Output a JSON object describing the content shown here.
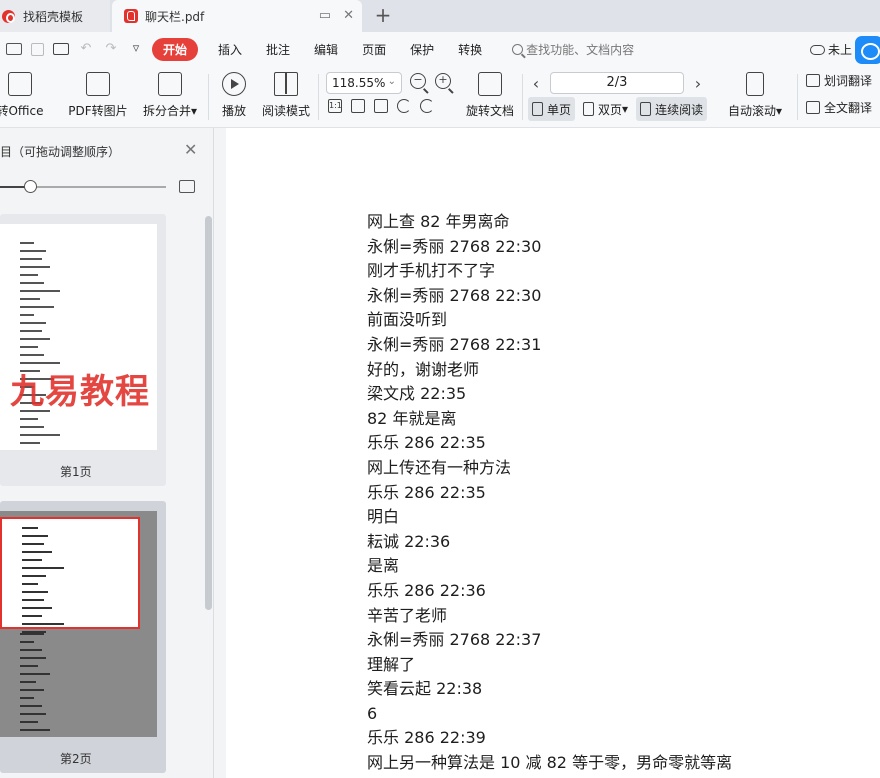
{
  "tabs": {
    "inactive_label": "找稻壳模板",
    "active_label": "聊天栏.pdf",
    "new_tab": "+"
  },
  "menu": {
    "start": "开始",
    "items": [
      "插入",
      "批注",
      "编辑",
      "页面",
      "保护",
      "转换"
    ],
    "search_placeholder": "查找功能、文档内容",
    "cloud_status": "未上"
  },
  "toolbar": {
    "to_office": "转Office",
    "pdf_to_image": "PDF转图片",
    "split_merge": "拆分合并",
    "play": "播放",
    "read_mode": "阅读模式",
    "zoom": "118.55%",
    "rotate_doc": "旋转文档",
    "page_indicator": "2/3",
    "single_page": "单页",
    "double_page": "双页",
    "continuous": "连续阅读",
    "auto_scroll": "自动滚动",
    "word_translate": "划词翻译",
    "full_translate": "全文翻译",
    "actual_size": "1:1"
  },
  "sidebar": {
    "title": "目（可拖动调整顺序）",
    "watermark": "九易教程",
    "page1_label": "第1页",
    "page2_label": "第2页"
  },
  "document": {
    "lines": [
      "网上查 82 年男离命",
      "永俐=秀丽 2768 22:30",
      "刚才手机打不了字",
      "永俐=秀丽 2768 22:30",
      "前面没听到",
      "永俐=秀丽 2768 22:31",
      "好的，谢谢老师",
      "梁文戍 22:35",
      "82 年就是离",
      "乐乐 286 22:35",
      "网上传还有一种方法",
      "乐乐 286 22:35",
      "明白",
      "耘诚 22:36",
      "是离",
      "乐乐 286 22:36",
      "辛苦了老师",
      "永俐=秀丽 2768 22:37",
      "理解了",
      "笑看云起 22:38",
      "6",
      "乐乐 286 22:39",
      "网上另一种算法是 10 减 82 等于零，男命零就等离"
    ]
  }
}
